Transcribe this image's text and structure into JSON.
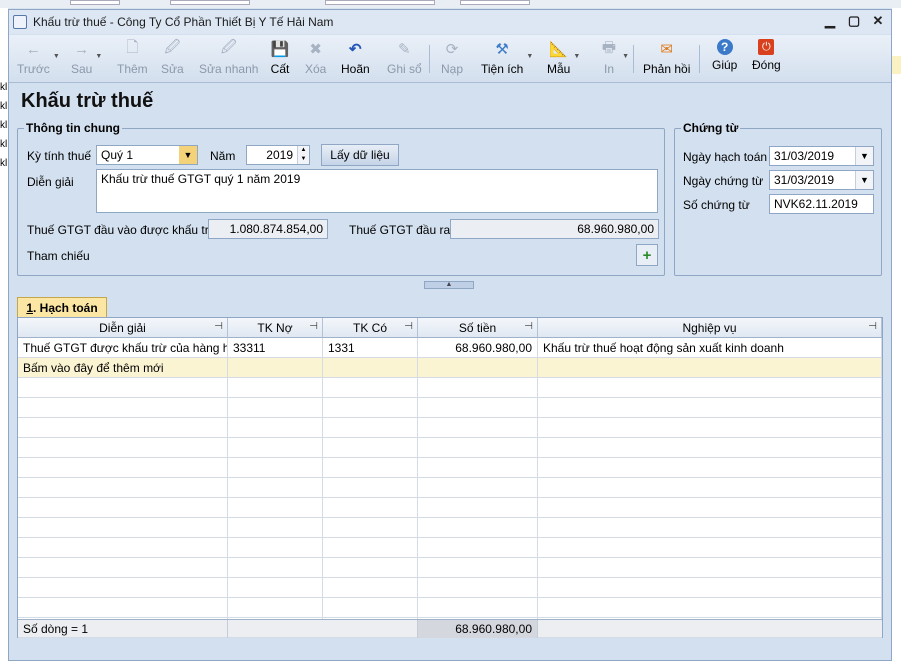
{
  "window": {
    "title": "Khấu trừ thuế - Công Ty Cổ Phần Thiết Bị Y Tế Hải Nam"
  },
  "background": {
    "left_rows": [
      "kl",
      "kl",
      "kl",
      "kl",
      "kl"
    ]
  },
  "toolbar": {
    "items": [
      {
        "label": "Trước",
        "icon": "←",
        "enabled": false
      },
      {
        "label": "Sau",
        "icon": "→",
        "enabled": false
      },
      {
        "label": "Thêm",
        "icon": "🗋",
        "enabled": false
      },
      {
        "label": "Sửa",
        "icon": "🖉",
        "enabled": false
      },
      {
        "label": "Sửa nhanh",
        "icon": "🖉",
        "enabled": false
      },
      {
        "label": "Cất",
        "icon": "💾",
        "enabled": true
      },
      {
        "label": "Xóa",
        "icon": "✖",
        "enabled": false
      },
      {
        "label": "Hoãn",
        "icon": "↶",
        "enabled": true
      },
      {
        "label": "Ghi sổ",
        "icon": "✎",
        "enabled": false
      },
      {
        "label": "Nạp",
        "icon": "⟳",
        "enabled": false
      },
      {
        "label": "Tiện ích",
        "icon": "⚒",
        "enabled": true
      },
      {
        "label": "Mẫu",
        "icon": "📐",
        "enabled": true
      },
      {
        "label": "In",
        "icon": "🖶",
        "enabled": false
      },
      {
        "label": "Phản hồi",
        "icon": "✉",
        "enabled": true
      },
      {
        "label": "Giúp",
        "icon": "?",
        "enabled": true
      },
      {
        "label": "Đóng",
        "icon": "⏻",
        "enabled": true
      }
    ]
  },
  "page": {
    "title": "Khấu trừ thuế"
  },
  "general": {
    "group_title": "Thông tin chung",
    "period_label": "Kỳ tính thuế",
    "period_value": "Quý 1",
    "year_label": "Năm",
    "year_value": "2019",
    "fetch_button": "Lấy dữ liệu",
    "description_label": "Diễn giải",
    "description_value": "Khấu trừ thuế GTGT quý 1 năm 2019",
    "vat_in_label": "Thuế GTGT đầu vào được khấu trừ",
    "vat_in_value": "1.080.874.854,00",
    "vat_out_label": "Thuế GTGT đầu ra",
    "vat_out_value": "68.960.980,00",
    "reference_label": "Tham chiếu"
  },
  "voucher": {
    "group_title": "Chứng từ",
    "posting_date_label": "Ngày hạch toán",
    "posting_date_value": "31/03/2019",
    "voucher_date_label": "Ngày chứng từ",
    "voucher_date_value": "31/03/2019",
    "voucher_no_label": "Số chứng từ",
    "voucher_no_value": "NVK62.11.2019"
  },
  "tab": {
    "number": "1",
    "label": ". Hạch toán"
  },
  "grid": {
    "headers": [
      "Diễn giải",
      "TK Nợ",
      "TK Có",
      "Số tiền",
      "Nghiệp vụ"
    ],
    "rows": [
      [
        "Thuế GTGT được khấu trừ của hàng hó",
        "33311",
        "1331",
        "68.960.980,00",
        "Khấu trừ thuế hoạt động sản xuất kinh doanh"
      ]
    ],
    "new_row_text": "Bấm vào đây để thêm mới",
    "footer_count": "Số dòng = 1",
    "footer_sum": "68.960.980,00"
  }
}
